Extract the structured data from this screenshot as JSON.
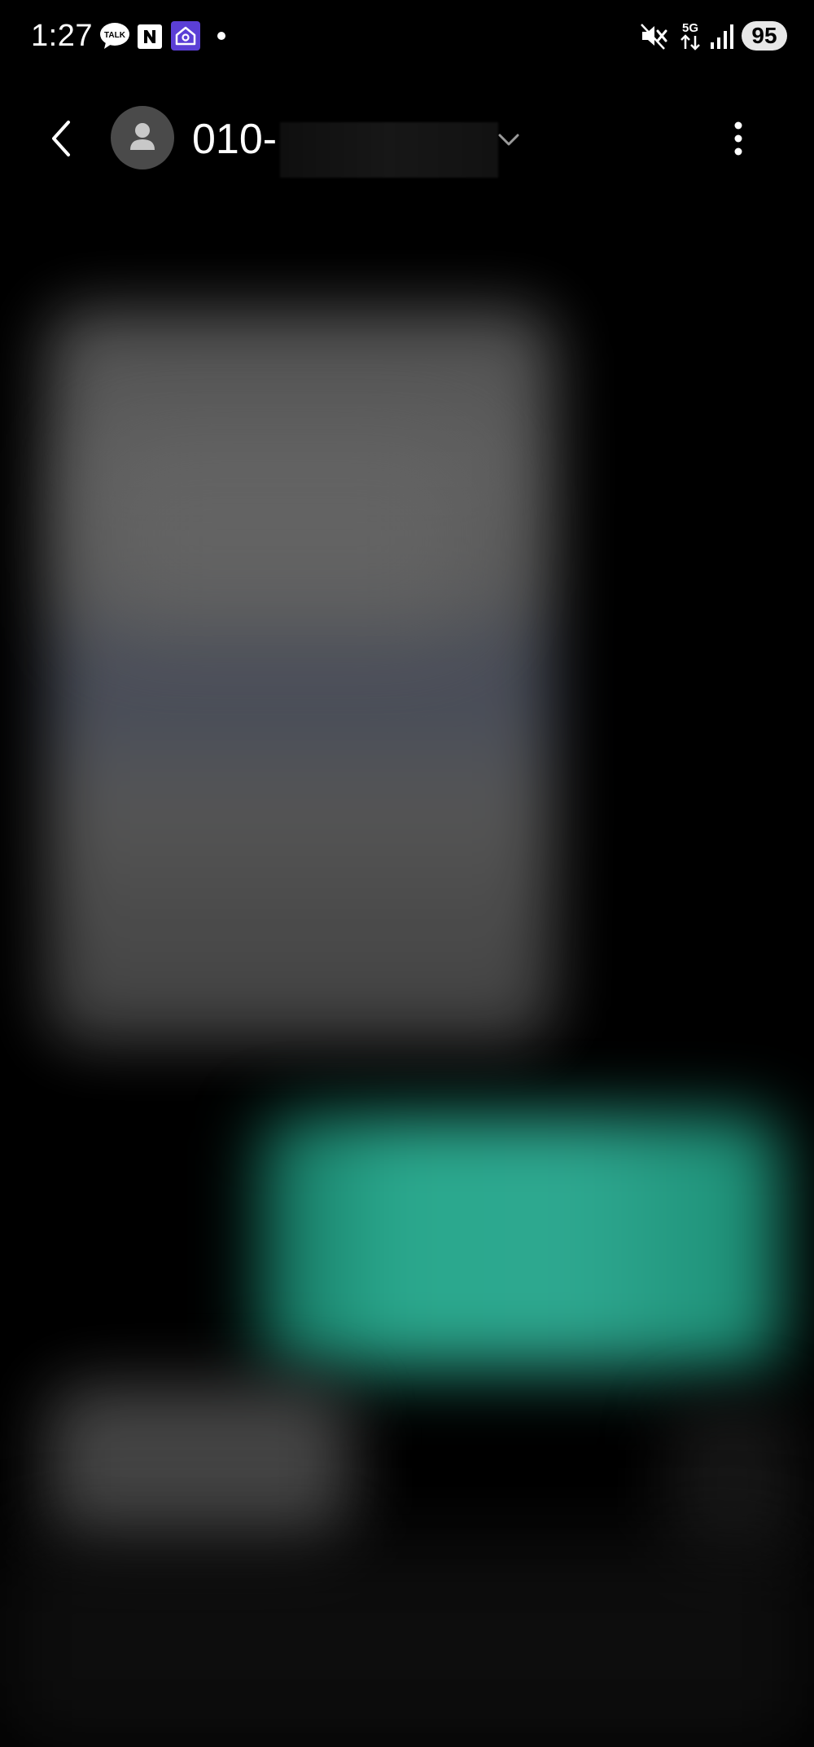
{
  "status_bar": {
    "time": "1:27",
    "notification_icons": [
      "kakaotalk-icon",
      "naver-icon",
      "home-app-icon",
      "notification-dot-icon"
    ],
    "system_icons": [
      "mute-icon",
      "5g-data-icon",
      "signal-icon"
    ],
    "network_label": "5G",
    "battery_level": "95"
  },
  "header": {
    "contact_number_prefix": "010-",
    "icons": {
      "back": "chevron-left-icon",
      "avatar": "person-icon",
      "expand": "chevron-down-icon",
      "more": "more-vertical-icon"
    }
  },
  "colors": {
    "background": "#000000",
    "sent_bubble": "#2aa88d",
    "received_bubble": "#5c5c5c",
    "avatar_bg": "#4a4a4a"
  }
}
